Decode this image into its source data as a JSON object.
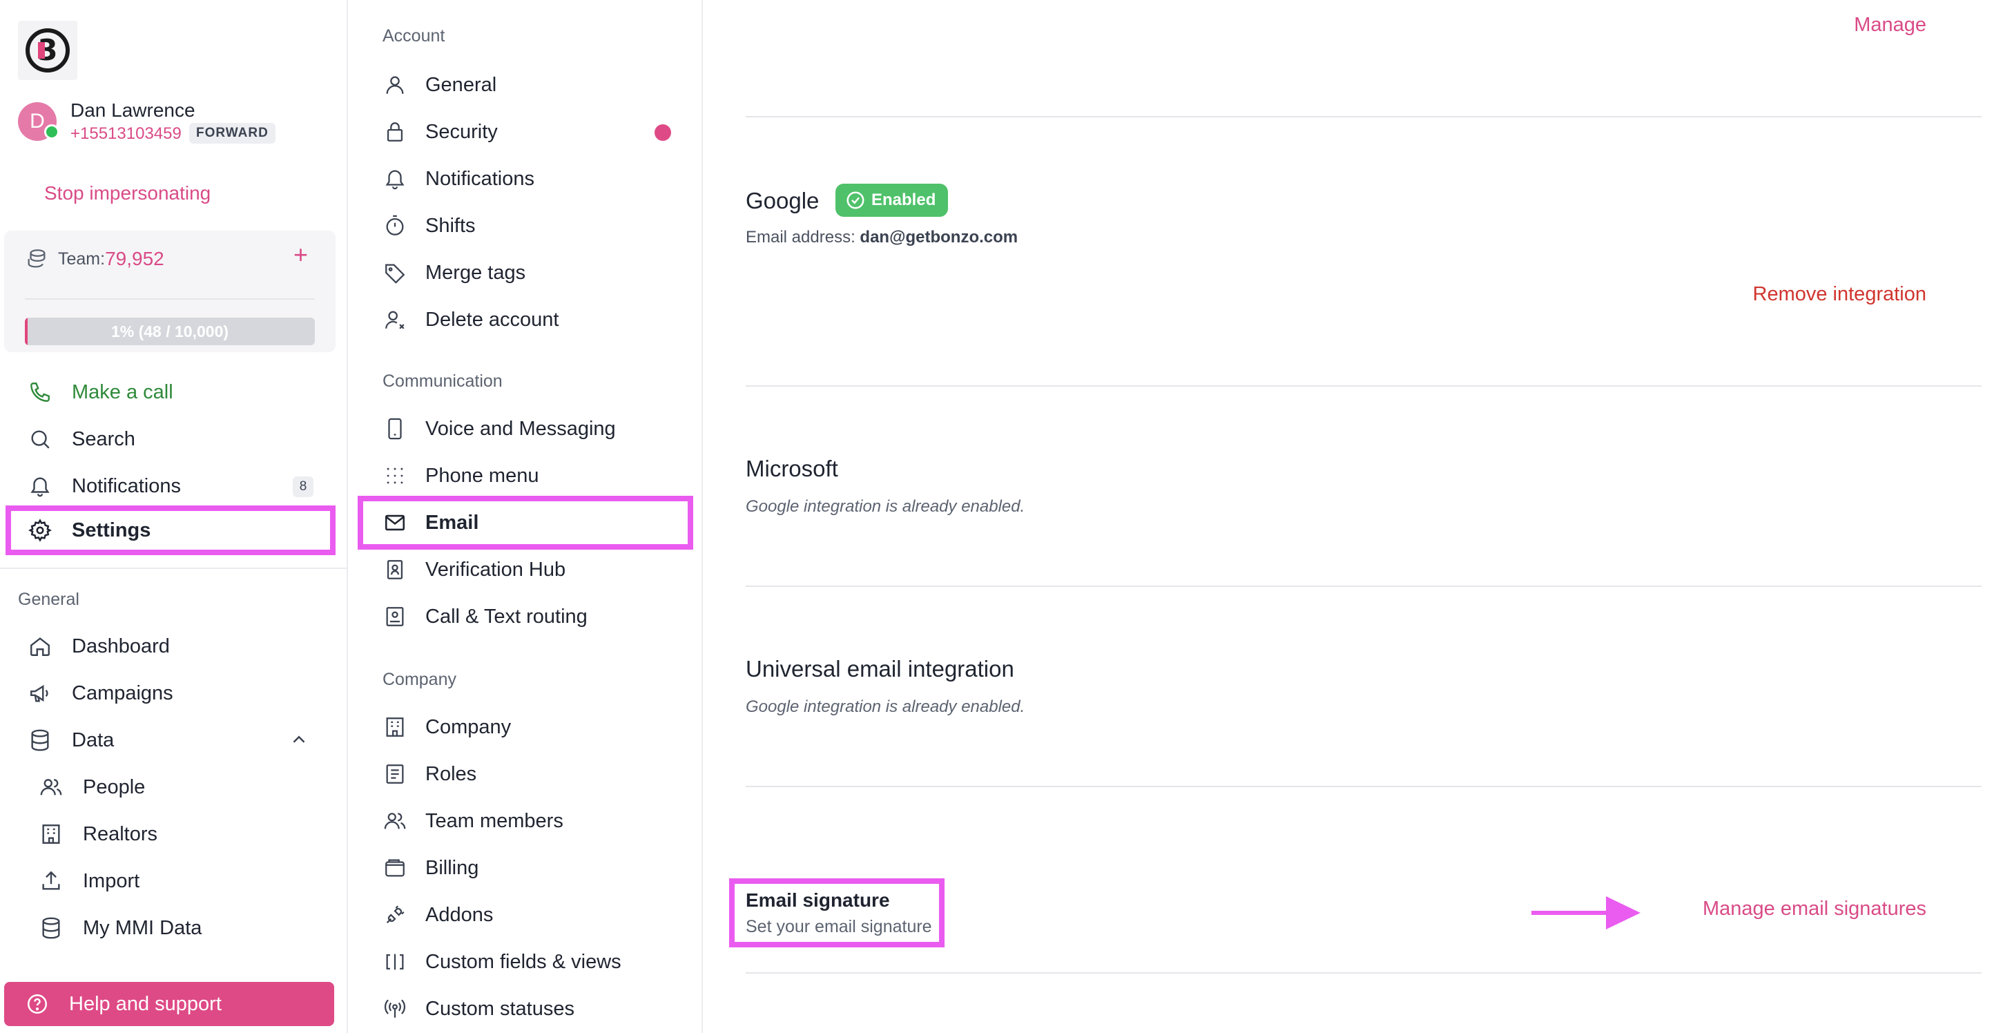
{
  "user": {
    "initial": "D",
    "name": "Dan Lawrence",
    "phone": "+15513103459",
    "badge": "FORWARD",
    "stop_label": "Stop impersonating"
  },
  "team": {
    "label": "Team:",
    "value": "79,952",
    "plus": "+",
    "progress_text": "1% (48 / 10,000)",
    "progress_fraction": 0.01
  },
  "sidebar": {
    "make_call": "Make a call",
    "search": "Search",
    "notifications": "Notifications",
    "notifications_count": "8",
    "settings": "Settings",
    "general_header": "General",
    "dashboard": "Dashboard",
    "campaigns": "Campaigns",
    "data": "Data",
    "people": "People",
    "realtors": "Realtors",
    "import": "Import",
    "my_mmi_data": "My MMI Data",
    "help": "Help and support"
  },
  "settings_nav": {
    "account_header": "Account",
    "general": "General",
    "security": "Security",
    "notifications": "Notifications",
    "shifts": "Shifts",
    "merge_tags": "Merge tags",
    "delete_account": "Delete account",
    "communication_header": "Communication",
    "voice_messaging": "Voice and Messaging",
    "phone_menu": "Phone menu",
    "email": "Email",
    "verification_hub": "Verification Hub",
    "call_text_routing": "Call & Text routing",
    "company_header": "Company",
    "company": "Company",
    "roles": "Roles",
    "team_members": "Team members",
    "billing": "Billing",
    "addons": "Addons",
    "custom_fields": "Custom fields & views",
    "custom_statuses": "Custom statuses"
  },
  "content": {
    "manage": "Manage",
    "google": {
      "title": "Google",
      "badge": "Enabled",
      "email_label": "Email address:",
      "email_value": "dan@getbonzo.com",
      "remove": "Remove integration"
    },
    "microsoft": {
      "title": "Microsoft",
      "note": "Google integration is already enabled."
    },
    "universal": {
      "title": "Universal email integration",
      "note": "Google integration is already enabled."
    },
    "signature": {
      "title": "Email signature",
      "subtitle": "Set your email signature",
      "manage": "Manage email signatures"
    }
  },
  "colors": {
    "accent": "#d94b87",
    "highlight": "#ea5cf0",
    "enabled": "#4fc16a",
    "danger": "#d0352f",
    "call_green": "#2f8a3a"
  }
}
